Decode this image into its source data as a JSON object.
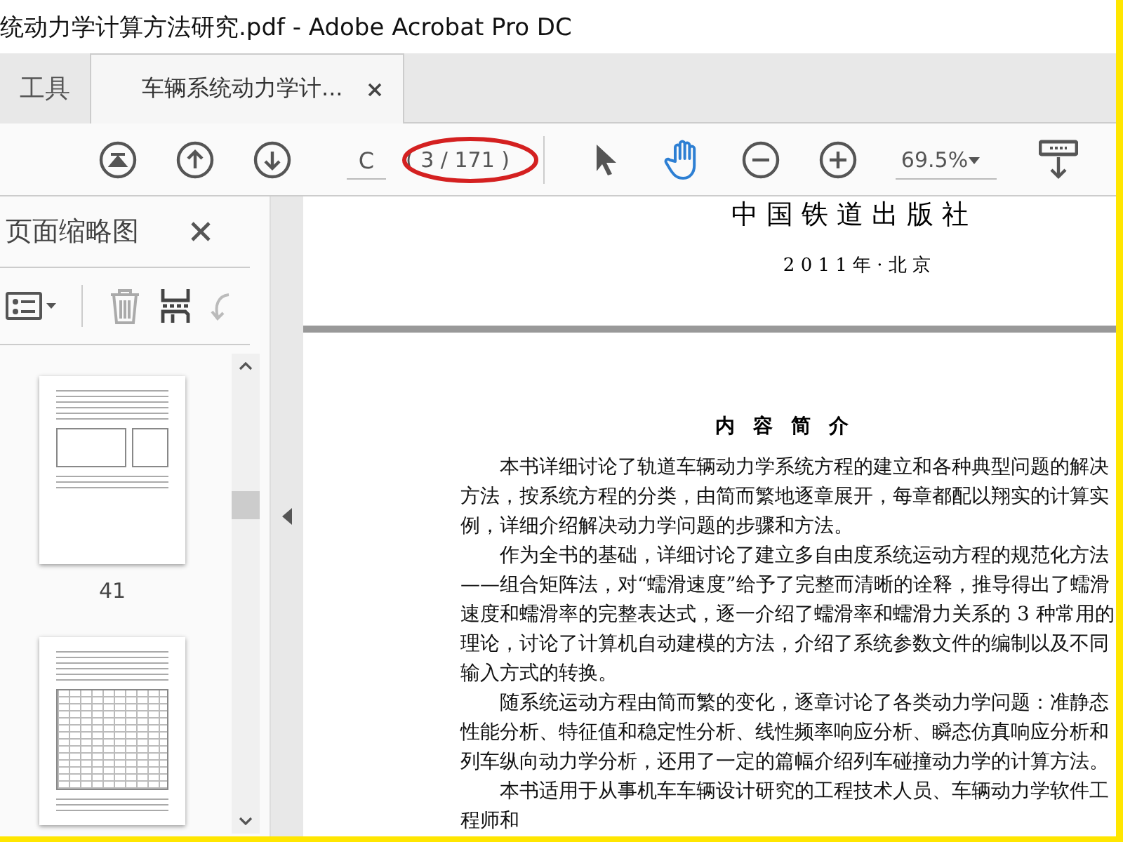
{
  "window": {
    "title": "统动力学计算方法研究.pdf - Adobe Acrobat Pro DC"
  },
  "tabs": [
    {
      "label": "工具",
      "selected": false,
      "closable": false
    },
    {
      "label": "车辆系统动力学计...",
      "selected": true,
      "closable": true
    }
  ],
  "toolbar": {
    "page_input": "C",
    "page_count": "( 3 / 171 )",
    "page_count_circled": true,
    "tools": [
      {
        "kind": "select",
        "selected": false
      },
      {
        "kind": "hand",
        "selected": true
      }
    ],
    "zoom": "69.5%"
  },
  "sidebar": {
    "title": "页面缩略图",
    "thumbnails": [
      {
        "kind": "diagram",
        "page": "41"
      },
      {
        "kind": "table"
      }
    ]
  },
  "document": {
    "publisher": "中 国 铁 道 出 版 社",
    "imprint": "2 0 1 1 年 · 北  京",
    "heading": "内 容 简 介",
    "paragraphs": [
      "本书详细讨论了轨道车辆动力学系统方程的建立和各种典型问题的解决方法，按系统方程的分类，由简而繁地逐章展开，每章都配以翔实的计算实例，详细介绍解决动力学问题的步骤和方法。",
      "作为全书的基础，详细讨论了建立多自由度系统运动方程的规范化方法——组合矩阵法，对“蠕滑速度”给予了完整而清晰的诠释，推导得出了蠕滑速度和蠕滑率的完整表达式，逐一介绍了蠕滑率和蠕滑力关系的 3 种常用的理论，讨论了计算机自动建模的方法，介绍了系统参数文件的编制以及不同输入方式的转换。",
      "随系统运动方程由简而繁的变化，逐章讨论了各类动力学问题：准静态性能分析、特征值和稳定性分析、线性频率响应分析、瞬态仿真响应分析和列车纵向动力学分析，还用了一定的篇幅介绍列车碰撞动力学的计算方法。",
      "本书适用于从事机车车辆设计研究的工程技术人员、车辆动力学软件工程师和"
    ]
  }
}
